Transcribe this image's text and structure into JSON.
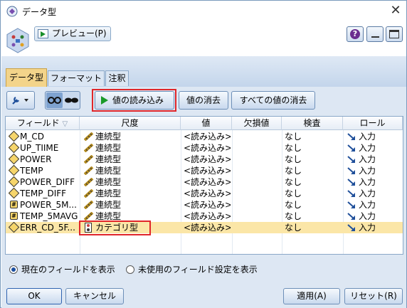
{
  "window": {
    "title": "データ型",
    "close_glyph": "✕"
  },
  "header": {
    "preview_label": "プレビュー(P)",
    "help_glyph": "?"
  },
  "tabs": [
    {
      "label": "データ型",
      "active": true
    },
    {
      "label": "フォーマット",
      "active": false
    },
    {
      "label": "注釈",
      "active": false
    }
  ],
  "toolbar": {
    "read_values_label": "値の読み込み",
    "clear_values_label": "値の消去",
    "clear_all_label": "すべての値の消去"
  },
  "table": {
    "columns": [
      "フィールド",
      "尺度",
      "値",
      "欠損値",
      "検査",
      "ロール"
    ],
    "sort_glyph": "▽",
    "rows": [
      {
        "field": "M_CD",
        "field_type": "diamond",
        "measure": "連続型",
        "measure_type": "ruler",
        "value": "<読み込み>",
        "missing": "",
        "check": "なし",
        "role": "入力"
      },
      {
        "field": "UP_TIIME",
        "field_type": "diamond",
        "measure": "連続型",
        "measure_type": "ruler",
        "value": "<読み込み>",
        "missing": "",
        "check": "なし",
        "role": "入力"
      },
      {
        "field": "POWER",
        "field_type": "diamond",
        "measure": "連続型",
        "measure_type": "ruler",
        "value": "<読み込み>",
        "missing": "",
        "check": "なし",
        "role": "入力"
      },
      {
        "field": "TEMP",
        "field_type": "diamond",
        "measure": "連続型",
        "measure_type": "ruler",
        "value": "<読み込み>",
        "missing": "",
        "check": "なし",
        "role": "入力"
      },
      {
        "field": "POWER_DIFF",
        "field_type": "diamond",
        "measure": "連続型",
        "measure_type": "ruler",
        "value": "<読み込み>",
        "missing": "",
        "check": "なし",
        "role": "入力"
      },
      {
        "field": "TEMP_DIFF",
        "field_type": "diamond",
        "measure": "連続型",
        "measure_type": "ruler",
        "value": "<読み込み>",
        "missing": "",
        "check": "なし",
        "role": "入力"
      },
      {
        "field": "POWER_5M...",
        "field_type": "hash",
        "measure": "連続型",
        "measure_type": "ruler",
        "value": "<読み込み>",
        "missing": "",
        "check": "なし",
        "role": "入力"
      },
      {
        "field": "TEMP_5MAVG",
        "field_type": "hash",
        "measure": "連続型",
        "measure_type": "ruler",
        "value": "<読み込み>",
        "missing": "",
        "check": "なし",
        "role": "入力"
      },
      {
        "field": "ERR_CD_5F...",
        "field_type": "diamond",
        "measure": "カテゴリ型",
        "measure_type": "category",
        "value": "<読み込み>",
        "missing": "",
        "check": "なし",
        "role": "入力",
        "selected": true
      }
    ]
  },
  "options": {
    "show_current_label": "現在のフィールドを表示",
    "show_unused_label": "未使用のフィールド設定を表示",
    "selected": "current"
  },
  "buttons": {
    "ok_label": "OK",
    "cancel_label": "キャンセル",
    "apply_label": "適用(A)",
    "reset_label": "リセット(R)"
  },
  "colors": {
    "highlight": "#e0262a",
    "selected_row": "#fbe6a7",
    "active_tab": "#f3d48a"
  }
}
